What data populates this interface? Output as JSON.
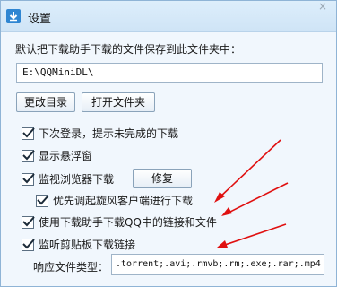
{
  "window": {
    "title": "设置",
    "close_glyph": "×"
  },
  "save_section": {
    "label": "默认把下载助手下载的文件保存到此文件夹中：",
    "path_value": "E:\\QQMiniDL\\",
    "change_dir_button": "更改目录",
    "open_folder_button": "打开文件夹"
  },
  "options": [
    {
      "label": "下次登录，提示未完成的下载",
      "checked": true
    },
    {
      "label": "显示悬浮窗",
      "checked": true
    },
    {
      "label": "监视浏览器下载",
      "checked": true
    },
    {
      "label": "优先调起旋风客户端进行下载",
      "checked": true
    },
    {
      "label": "使用下载助手下载QQ中的链接和文件",
      "checked": true
    },
    {
      "label": "监听剪贴板下载链接",
      "checked": true
    }
  ],
  "repair_button": "修复",
  "file_types": {
    "label": "响应文件类型：",
    "value": ".torrent;.avi;.rmvb;.rm;.exe;.rar;.mp4"
  },
  "colors": {
    "accent": "#2f86d2",
    "arrow": "#e01010",
    "background": "#f1f7fd"
  },
  "icons": [
    "download-arrow-icon",
    "close-icon",
    "checkmark-icon"
  ]
}
